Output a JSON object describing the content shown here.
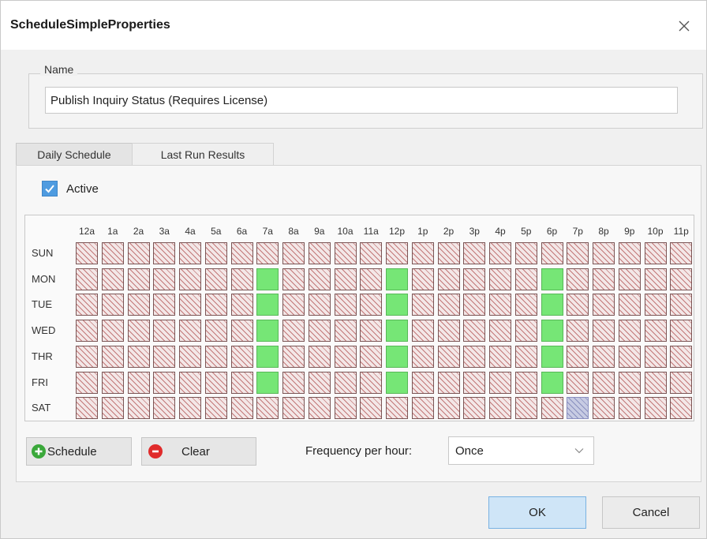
{
  "dialog": {
    "title": "ScheduleSimpleProperties",
    "close_icon": "close-icon"
  },
  "name_group": {
    "legend": "Name",
    "value": "Publish Inquiry Status (Requires License)"
  },
  "tabs": [
    {
      "label": "Daily Schedule",
      "selected": true
    },
    {
      "label": "Last Run Results",
      "selected": false
    }
  ],
  "active": {
    "label": "Active",
    "checked": true
  },
  "grid": {
    "hours": [
      "12a",
      "1a",
      "2a",
      "3a",
      "4a",
      "5a",
      "6a",
      "7a",
      "8a",
      "9a",
      "10a",
      "11a",
      "12p",
      "1p",
      "2p",
      "3p",
      "4p",
      "5p",
      "6p",
      "7p",
      "8p",
      "9p",
      "10p",
      "11p"
    ],
    "days": [
      "SUN",
      "MON",
      "TUE",
      "WED",
      "THR",
      "FRI",
      "SAT"
    ],
    "scheduled_hours_by_day": {
      "SUN": [],
      "MON": [
        "7a",
        "12p",
        "6p"
      ],
      "TUE": [
        "7a",
        "12p",
        "6p"
      ],
      "WED": [
        "7a",
        "12p",
        "6p"
      ],
      "THR": [
        "7a",
        "12p",
        "6p"
      ],
      "FRI": [
        "7a",
        "12p",
        "6p"
      ],
      "SAT": []
    },
    "selected_cell": {
      "day": "SAT",
      "hour": "7p"
    },
    "colors": {
      "scheduled": "#76e676",
      "unscheduled": "#c37a7a",
      "selected": "#8a90bf"
    }
  },
  "toolbar": {
    "schedule_label": "Schedule",
    "schedule_icon": "add-icon",
    "clear_label": "Clear",
    "clear_icon": "remove-icon",
    "frequency_label": "Frequency per hour:",
    "frequency_value": "Once"
  },
  "footer": {
    "ok_label": "OK",
    "cancel_label": "Cancel"
  }
}
